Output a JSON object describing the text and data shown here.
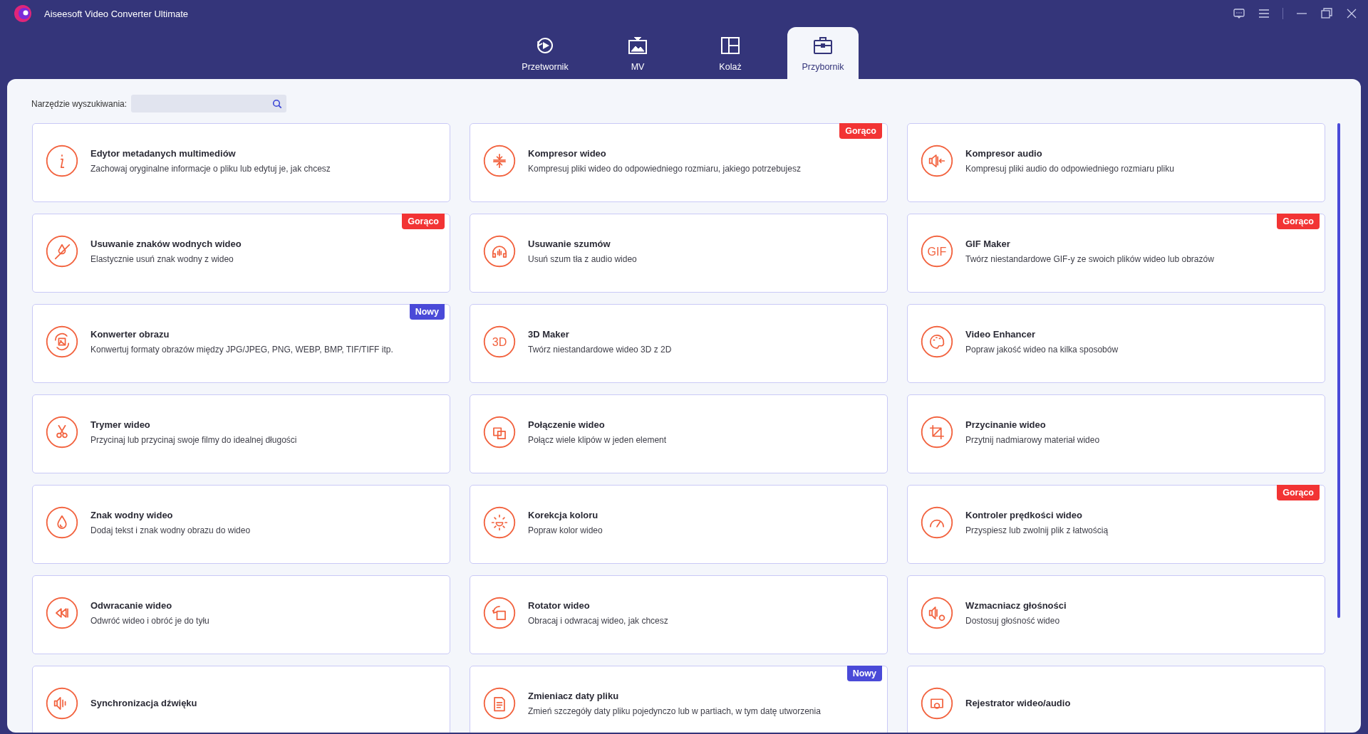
{
  "window": {
    "title": "Aiseesoft Video Converter Ultimate"
  },
  "tabs": [
    {
      "label": "Przetwornik",
      "selected": false
    },
    {
      "label": "MV",
      "selected": false
    },
    {
      "label": "Kolaż",
      "selected": false
    },
    {
      "label": "Przybornik",
      "selected": true
    }
  ],
  "search": {
    "label": "Narzędzie wyszukiwania:"
  },
  "tools": [
    {
      "title": "Edytor metadanych multimediów",
      "description": "Zachowaj oryginalne informacje o pliku lub edytuj je, jak chcesz"
    },
    {
      "title": "Kompresor wideo",
      "description": "Kompresuj pliki wideo do odpowiedniego rozmiaru, jakiego potrzebujesz",
      "badge": {
        "kind": "hot",
        "text": "Gorąco"
      }
    },
    {
      "title": "Kompresor audio",
      "description": "Kompresuj pliki audio do odpowiedniego rozmiaru pliku"
    },
    {
      "title": "Usuwanie znaków wodnych wideo",
      "description": "Elastycznie usuń znak wodny z wideo",
      "badge": {
        "kind": "hot",
        "text": "Gorąco"
      }
    },
    {
      "title": "Usuwanie szumów",
      "description": "Usuń szum tła z audio wideo"
    },
    {
      "title": "GIF Maker",
      "description": "Twórz niestandardowe GIF-y ze swoich plików wideo lub obrazów",
      "icon_text": "GIF",
      "badge": {
        "kind": "hot",
        "text": "Gorąco"
      }
    },
    {
      "title": "Konwerter obrazu",
      "description": "Konwertuj formaty obrazów między JPG/JPEG, PNG, WEBP, BMP, TIF/TIFF itp.",
      "badge": {
        "kind": "new",
        "text": "Nowy"
      }
    },
    {
      "title": "3D Maker",
      "description": "Twórz niestandardowe wideo 3D z 2D",
      "icon_text": "3D"
    },
    {
      "title": "Video Enhancer",
      "description": "Popraw jakość wideo na kilka sposobów"
    },
    {
      "title": "Trymer wideo",
      "description": "Przycinaj lub przycinaj swoje filmy do idealnej długości"
    },
    {
      "title": "Połączenie wideo",
      "description": "Połącz wiele klipów w jeden element"
    },
    {
      "title": "Przycinanie wideo",
      "description": "Przytnij nadmiarowy materiał wideo"
    },
    {
      "title": "Znak wodny wideo",
      "description": "Dodaj tekst i znak wodny obrazu do wideo"
    },
    {
      "title": "Korekcja koloru",
      "description": "Popraw kolor wideo"
    },
    {
      "title": "Kontroler prędkości wideo",
      "description": "Przyspiesz lub zwolnij plik z łatwością",
      "badge": {
        "kind": "hot",
        "text": "Gorąco"
      }
    },
    {
      "title": "Odwracanie wideo",
      "description": "Odwróć wideo i obróć je do tyłu"
    },
    {
      "title": "Rotator wideo",
      "description": "Obracaj i odwracaj wideo, jak chcesz"
    },
    {
      "title": "Wzmacniacz głośności",
      "description": "Dostosuj głośność wideo"
    },
    {
      "title": "Synchronizacja dźwięku"
    },
    {
      "title": "Zmieniacz daty pliku",
      "description": "Zmień szczegóły daty pliku pojedynczo lub w partiach, w tym datę utworzenia",
      "badge": {
        "kind": "new",
        "text": "Nowy"
      }
    },
    {
      "title": "Rejestrator wideo/audio"
    }
  ]
}
